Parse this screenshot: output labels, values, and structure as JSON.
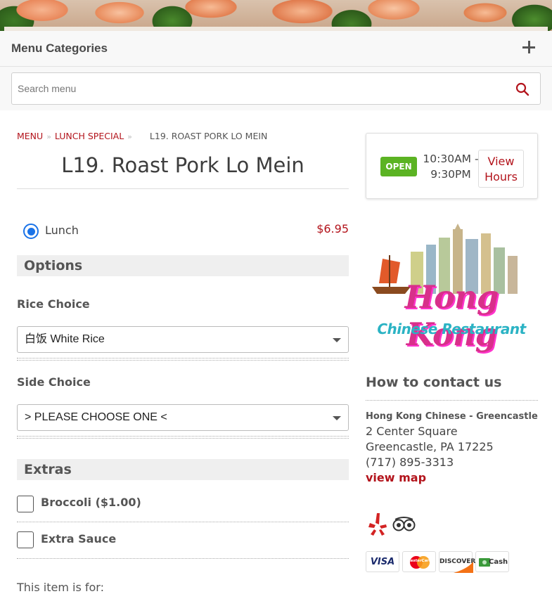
{
  "header": {
    "categories_label": "Menu Categories",
    "search_placeholder": "Search menu"
  },
  "breadcrumb": {
    "menu": "MENU",
    "lunch": "LUNCH SPECIAL",
    "current": "L19. ROAST PORK LO MEIN"
  },
  "item": {
    "title": "L19. Roast Pork Lo Mein",
    "size_label": "Lunch",
    "size_price": "$6.95"
  },
  "options": {
    "heading": "Options",
    "rice_label": "Rice Choice",
    "rice_value": "白饭 White Rice",
    "side_label": "Side Choice",
    "side_value": "> PLEASE CHOOSE ONE <"
  },
  "extras": {
    "heading": "Extras",
    "items": [
      {
        "label": "Broccoli ($1.00)"
      },
      {
        "label": "Extra Sauce"
      }
    ]
  },
  "for_label": "This item is for:",
  "hours": {
    "status": "OPEN",
    "time_line1": "10:30AM -",
    "time_line2": "9:30PM",
    "view_line1": "View",
    "view_line2": "Hours"
  },
  "logo": {
    "line1": "Hong Kong",
    "line2": "Chinese Restaurant"
  },
  "contact": {
    "heading": "How to contact us",
    "name": "Hong Kong Chinese - Greencastle",
    "address1": "2 Center Square",
    "address2": "Greencastle, PA 17225",
    "phone": "(717) 895-3313",
    "map_link": "view map"
  },
  "payments": {
    "visa": "VISA",
    "mastercard": "MasterCard",
    "discover": "DISCOVER",
    "cash": "Cash"
  },
  "colors": {
    "accent_red": "#b3141c",
    "open_green": "#5bb323",
    "radio_blue": "#1a73e8"
  }
}
